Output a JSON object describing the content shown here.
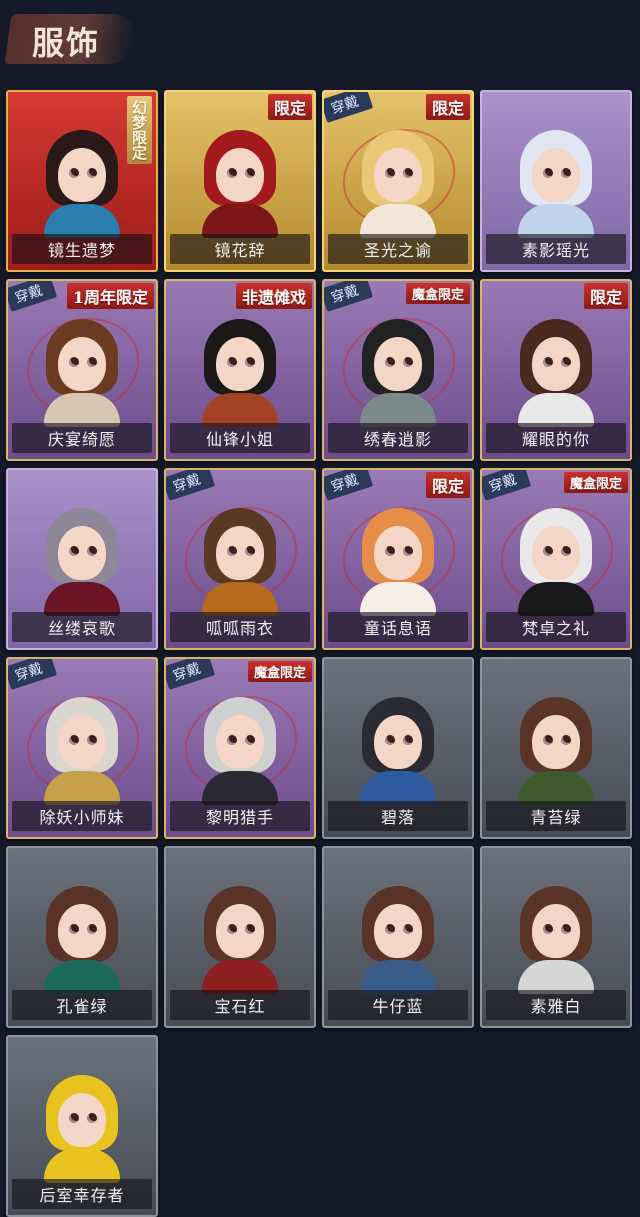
{
  "header": {
    "title": "服饰"
  },
  "costumes": [
    {
      "name": "镜生遗梦",
      "style": "red",
      "tag": "幻梦限定",
      "tag_style": "vertical",
      "worn": false,
      "hair": "#2a1a1a",
      "outfit": "#2a7fb0"
    },
    {
      "name": "镜花辞",
      "style": "gold",
      "tag": "限定",
      "tag_style": "normal",
      "worn": false,
      "hair": "#a2191e",
      "outfit": "#7d1616"
    },
    {
      "name": "圣光之谕",
      "style": "gold",
      "tag": "限定",
      "tag_style": "normal",
      "worn": true,
      "hair": "#e8c777",
      "outfit": "#f2e6d6"
    },
    {
      "name": "素影瑶光",
      "style": "lav",
      "tag": "",
      "tag_style": "normal",
      "worn": false,
      "hair": "#dfe6f2",
      "outfit": "#bfd3ea"
    },
    {
      "name": "庆宴绮愿",
      "style": "purple",
      "tag": "1周年限定",
      "tag_style": "normal",
      "worn": true,
      "hair": "#6b3b22",
      "outfit": "#d9c6b2"
    },
    {
      "name": "仙锋小姐",
      "style": "purple",
      "tag": "非遗傩戏",
      "tag_style": "normal",
      "worn": false,
      "hair": "#1b1818",
      "outfit": "#a24224"
    },
    {
      "name": "绣春逍影",
      "style": "purple",
      "tag": "魔盒限定",
      "tag_style": "small",
      "worn": true,
      "hair": "#222222",
      "outfit": "#7a8a8a"
    },
    {
      "name": "耀眼的你",
      "style": "purple",
      "tag": "限定",
      "tag_style": "normal",
      "worn": false,
      "hair": "#4a2a1e",
      "outfit": "#e8e8e8"
    },
    {
      "name": "丝缕哀歌",
      "style": "lav",
      "tag": "",
      "tag_style": "normal",
      "worn": false,
      "hair": "#8e8798",
      "outfit": "#6a1426"
    },
    {
      "name": "呱呱雨衣",
      "style": "purple",
      "tag": "",
      "tag_style": "normal",
      "worn": true,
      "hair": "#5a3a24",
      "outfit": "#b56a1e"
    },
    {
      "name": "童话息语",
      "style": "purple",
      "tag": "限定",
      "tag_style": "normal",
      "worn": true,
      "hair": "#e58e49",
      "outfit": "#f6efe8"
    },
    {
      "name": "梵卓之礼",
      "style": "purple",
      "tag": "魔盒限定",
      "tag_style": "small",
      "worn": true,
      "hair": "#e8e8e8",
      "outfit": "#1a1a1a"
    },
    {
      "name": "除妖小师妹",
      "style": "purple",
      "tag": "",
      "tag_style": "normal",
      "worn": true,
      "hair": "#d9d5cf",
      "outfit": "#c7a04a"
    },
    {
      "name": "黎明猎手",
      "style": "purple",
      "tag": "魔盒限定",
      "tag_style": "small",
      "worn": true,
      "hair": "#cfcfcf",
      "outfit": "#2a2a32"
    },
    {
      "name": "碧落",
      "style": "gray",
      "tag": "",
      "tag_style": "normal",
      "worn": false,
      "hair": "#2b2b33",
      "outfit": "#2e5aa0"
    },
    {
      "name": "青苔绿",
      "style": "gray",
      "tag": "",
      "tag_style": "normal",
      "worn": false,
      "hair": "#5a3426",
      "outfit": "#3f5a2e"
    },
    {
      "name": "孔雀绿",
      "style": "gray",
      "tag": "",
      "tag_style": "normal",
      "worn": false,
      "hair": "#5a3426",
      "outfit": "#1e6a5a"
    },
    {
      "name": "宝石红",
      "style": "gray",
      "tag": "",
      "tag_style": "normal",
      "worn": false,
      "hair": "#5a3426",
      "outfit": "#8e1e1e"
    },
    {
      "name": "牛仔蓝",
      "style": "gray",
      "tag": "",
      "tag_style": "normal",
      "worn": false,
      "hair": "#5a3426",
      "outfit": "#3a5c8a"
    },
    {
      "name": "素雅白",
      "style": "gray",
      "tag": "",
      "tag_style": "normal",
      "worn": false,
      "hair": "#5a3426",
      "outfit": "#d6d6d6"
    },
    {
      "name": "后室幸存者",
      "style": "gray",
      "tag": "",
      "tag_style": "normal",
      "worn": false,
      "hair": "#e8c21e",
      "outfit": "#e8c21e"
    }
  ],
  "worn_label": "穿戴"
}
